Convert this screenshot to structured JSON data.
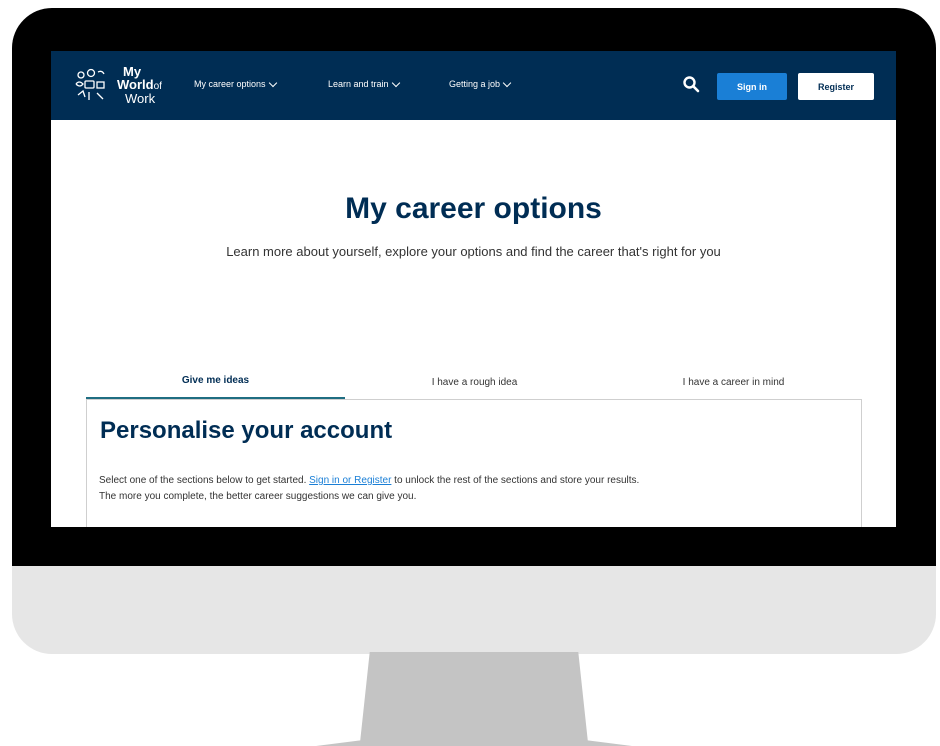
{
  "logo": {
    "line1": "My",
    "line2": "World",
    "line2_suffix": "of",
    "line3": "Work"
  },
  "nav": {
    "items": [
      {
        "label": "My career options"
      },
      {
        "label": "Learn and train"
      },
      {
        "label": "Getting a job"
      }
    ],
    "search_icon": "search-icon",
    "signin_label": "Sign in",
    "register_label": "Register"
  },
  "hero": {
    "title": "My career options",
    "subtitle": "Learn more about yourself, explore your options and find the career that's right for you"
  },
  "tabs": [
    {
      "label": "Give me ideas",
      "active": true
    },
    {
      "label": "I have a rough idea",
      "active": false
    },
    {
      "label": "I have a career in mind",
      "active": false
    }
  ],
  "panel": {
    "title": "Personalise your account",
    "text_before": "Select one of the sections below to get started. ",
    "link": "Sign in or Register",
    "text_after": " to unlock the rest of the sections and store your results.",
    "text_line2": "The more you complete, the better career suggestions we can give you."
  },
  "colors": {
    "navy": "#002d54",
    "accent_blue": "#1a7fd6",
    "tab_underline": "#1f6e82"
  }
}
